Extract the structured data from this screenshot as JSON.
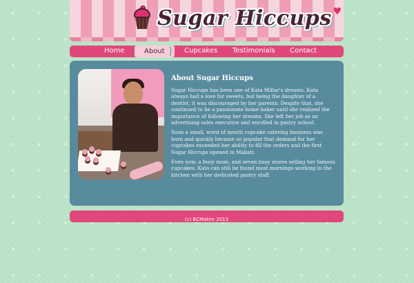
{
  "brand": {
    "name": "Sugar Hiccups"
  },
  "nav": {
    "items": [
      {
        "label": "Home",
        "active": false
      },
      {
        "label": "About",
        "active": true
      },
      {
        "label": "Cupcakes",
        "active": false
      },
      {
        "label": "Testimonials",
        "active": false
      },
      {
        "label": "Contact",
        "active": false
      }
    ]
  },
  "about": {
    "heading": "About Sugar Hiccups",
    "paragraphs": [
      "Sugar Hiccups has been one of Kata Millar's dreams. Kata always had a love for sweets, but being the daughter of a dentist, it was discouraged by her parents. Despite that, she continued to be a passionate home baker until she realized the importance of following her dreams. She left her job as an advertising sales executive and enrolled in pastry school.",
      "Soon a small, word of mouth cupcake catering business was born and quickly became so popular that demand for her cupcakes exceeded her ability to fill the orders and the first Sugar Hiccups opened in Makati.",
      "Even now, a busy mom, and seven busy stores selling her famous cupcakes, Kata can still be found most mornings working in the kitchen with her dedicated pastry staff."
    ]
  },
  "footer": {
    "text": "(c) BCMatire 2013"
  },
  "colors": {
    "background": "#b9e2c7",
    "nav": "#e0477a",
    "panel": "#588b9e",
    "logo": "#4a2333",
    "accent": "#56a8b2"
  }
}
